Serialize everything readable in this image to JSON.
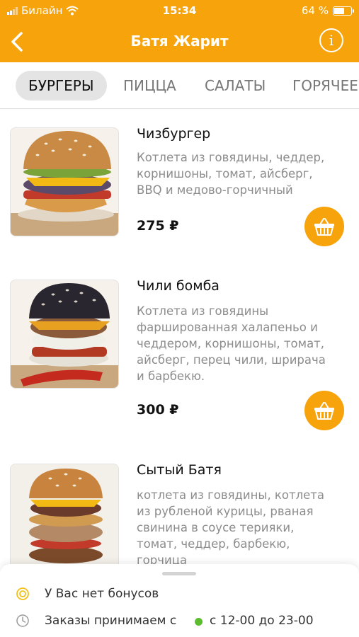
{
  "status_bar": {
    "carrier": "Билайн",
    "time": "15:34",
    "battery": "64 %",
    "battery_level": 0.64
  },
  "nav": {
    "title": "Батя Жарит"
  },
  "tabs": [
    "БУРГЕРЫ",
    "ПИЦЦА",
    "САЛАТЫ",
    "ГОРЯЧЕЕ"
  ],
  "products": [
    {
      "name": "Чизбургер",
      "desc": [
        "Котлета из говядины, чеддер,",
        "корнишоны, томат, айсберг,",
        "BBQ и медово-горчичный"
      ],
      "price": "275 ₽"
    },
    {
      "name": "Чили бомба",
      "desc": [
        "Котлета из говядины",
        "фаршированная халапеньо и",
        "чеддером, корнишоны, томат,",
        "айсберг, перец чили, шрирача",
        "и барбекю."
      ],
      "price": "300 ₽"
    },
    {
      "name": "Сытый Батя",
      "desc": [
        "котлета из говядины, котлета",
        "из рубленой курицы, рваная",
        "свинина в соусе терияки,",
        "томат, чеддер, барбекю,",
        "горчица"
      ]
    }
  ],
  "bottom_sheet": {
    "bonus_text": "У Вас нет бонусов",
    "orders_text": "Заказы принимаем с",
    "hours": "с 12-00 до 23-00"
  },
  "colors": {
    "accent": "#f7a30c",
    "open_status": "#5cbb2e"
  }
}
